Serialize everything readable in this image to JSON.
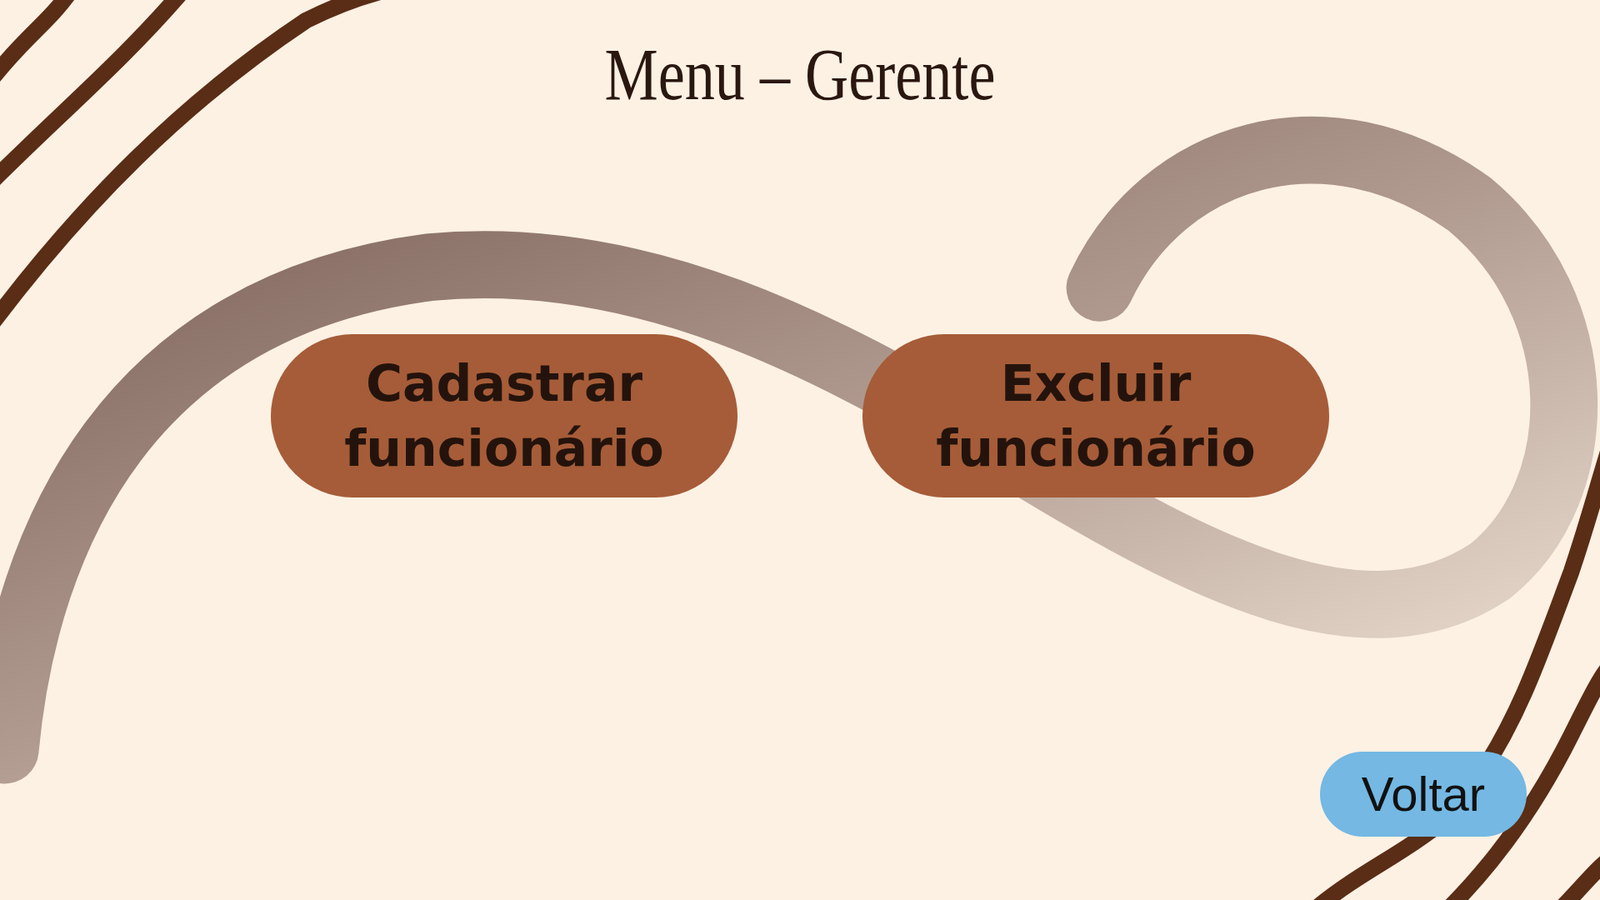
{
  "title": "Menu – Gerente",
  "actions": [
    {
      "label": "Cadastrar funcionário"
    },
    {
      "label": "Excluir funcionário"
    }
  ],
  "back_button": "Voltar"
}
